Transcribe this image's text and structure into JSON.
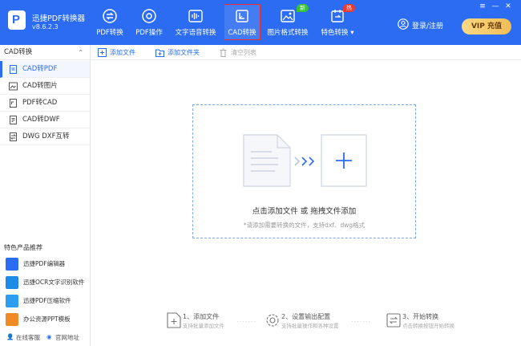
{
  "app": {
    "name": "迅捷PDF转换器",
    "version": "v8.6.2.3",
    "logo_letter": "P"
  },
  "tabs": [
    {
      "label": "PDF转换"
    },
    {
      "label": "PDF操作"
    },
    {
      "label": "文字语音转换"
    },
    {
      "label": "CAD转换"
    },
    {
      "label": "图片格式转换"
    },
    {
      "label": "特色转换"
    }
  ],
  "badges": {
    "new": "新",
    "hot": "热"
  },
  "account": {
    "login": "登录/注册",
    "vip": "VIP 充值"
  },
  "sidebar": {
    "section_title": "CAD转换",
    "items": [
      {
        "label": "CAD转PDF"
      },
      {
        "label": "CAD转图片"
      },
      {
        "label": "PDF转CAD"
      },
      {
        "label": "CAD转DWF"
      },
      {
        "label": "DWG DXF互转"
      }
    ],
    "featured_title": "特色产品推荐",
    "featured": [
      {
        "label": "迅捷PDF编辑器"
      },
      {
        "label": "迅捷OCR文字识别软件"
      },
      {
        "label": "迅捷PDF压缩软件"
      },
      {
        "label": "办公资源PPT模板"
      }
    ],
    "footer": {
      "online_service": "在线客服",
      "website": "官网地址"
    }
  },
  "toolbar": {
    "add_file": "添加文件",
    "add_folder": "添加文件夹",
    "clear_list": "清空列表"
  },
  "dropzone": {
    "main_text": "点击添加文件 或 拖拽文件添加",
    "sub_text": "*请添加需要转换的文件，支持dxf、dwg格式"
  },
  "steps": [
    {
      "title": "1、添加文件",
      "desc": "支持批量添加文件"
    },
    {
      "title": "2、设置输出配置",
      "desc": "支持批量操作和各种设置"
    },
    {
      "title": "3、开始转换",
      "desc": "点击转换按钮开始转换"
    }
  ],
  "colors": {
    "primary": "#2b6cf2",
    "active_border": "#e83030",
    "vip": "#f2bd55"
  }
}
